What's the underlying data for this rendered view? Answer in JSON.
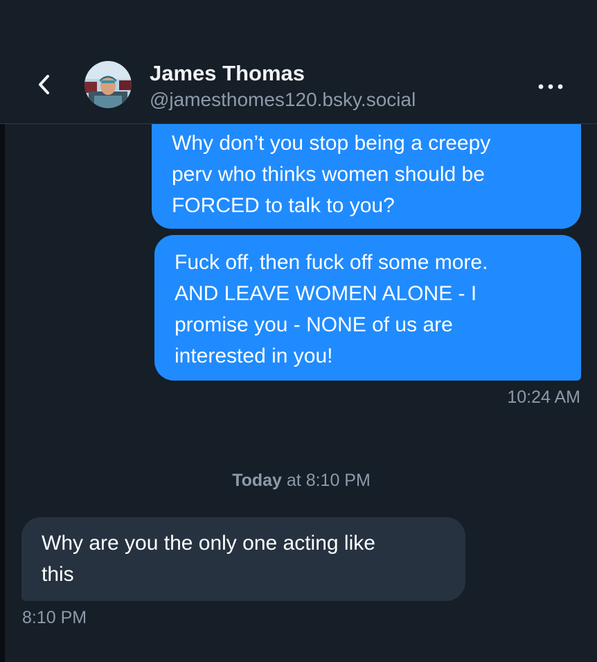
{
  "header": {
    "back_icon": "chevron-left-icon",
    "display_name": "James Thomas",
    "handle": "@jamesthomes120.bsky.social",
    "more_icon": "more-horizontal-icon"
  },
  "messages": [
    {
      "direction": "outgoing",
      "text": "Why don’t you stop being a creepy\nperv who thinks women should be\nFORCED to talk to you?"
    },
    {
      "direction": "outgoing",
      "text": "Fuck off, then fuck off some more.\nAND LEAVE WOMEN ALONE - I\npromise you - NONE of us are\ninterested in you!",
      "time": "10:24 AM"
    },
    {
      "direction": "incoming",
      "text": "Why are you the only one acting like\nthis",
      "time": "8:10 PM"
    }
  ],
  "date_separator": {
    "day": "Today",
    "rest": " at 8:10 PM"
  },
  "colors": {
    "background": "#161e27",
    "outgoing_bubble": "#208bfe",
    "incoming_bubble": "#263240",
    "muted_text": "#8c9aab"
  }
}
